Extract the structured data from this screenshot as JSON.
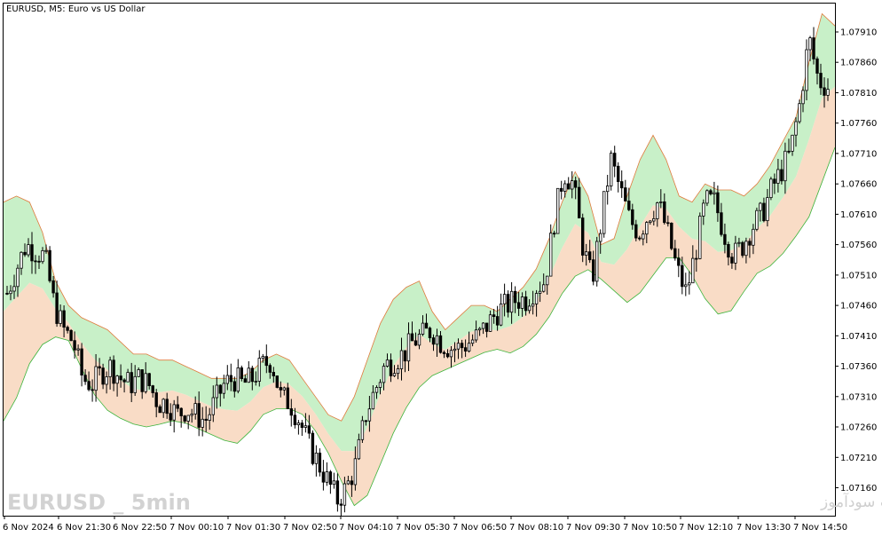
{
  "header": {
    "title": "EURUSD, M5:  Euro vs US Dollar"
  },
  "watermarks": {
    "left": "EURUSD _ 5min",
    "right": "انتشار در سایت سودآموز"
  },
  "colors": {
    "upper_band": "#c8f0c8",
    "lower_band": "#f9dcc6",
    "band_line": "#e07a3c",
    "candle": "#000000",
    "grid_frame": "#000000"
  },
  "chart_data": {
    "type": "candlestick",
    "symbol": "EURUSD",
    "timeframe": "M5",
    "ylim": [
      1.0712,
      1.0794
    ],
    "y_ticks": [
      "1.07910",
      "1.07860",
      "1.07810",
      "1.07760",
      "1.07710",
      "1.07660",
      "1.07610",
      "1.07560",
      "1.07510",
      "1.07460",
      "1.07410",
      "1.07360",
      "1.07310",
      "1.07260",
      "1.07210",
      "1.07160"
    ],
    "x_ticks": [
      "6 Nov 2024",
      "6 Nov 21:30",
      "6 Nov 22:50",
      "7 Nov 00:10",
      "7 Nov 01:30",
      "7 Nov 02:50",
      "7 Nov 04:10",
      "7 Nov 05:30",
      "7 Nov 06:50",
      "7 Nov 08:10",
      "7 Nov 09:30",
      "7 Nov 10:50",
      "7 Nov 12:10",
      "7 Nov 13:30",
      "7 Nov 14:50"
    ],
    "close_path": [
      1.0748,
      1.0752,
      1.0756,
      1.0755,
      1.0754,
      1.0746,
      1.0742,
      1.074,
      1.0734,
      1.0733,
      1.0735,
      1.0736,
      1.0734,
      1.0733,
      1.0734,
      1.0733,
      1.073,
      1.073,
      1.0728,
      1.0729,
      1.0728,
      1.0727,
      1.073,
      1.0733,
      1.0734,
      1.0733,
      1.0734,
      1.0736,
      1.0737,
      1.0731,
      1.073,
      1.0727,
      1.0723,
      1.072,
      1.0717,
      1.0714,
      1.0716,
      1.072,
      1.0728,
      1.0732,
      1.0736,
      1.0737,
      1.0738,
      1.074,
      1.0741,
      1.0742,
      1.074,
      1.0739,
      1.0739,
      1.074,
      1.0741,
      1.0743,
      1.0745,
      1.0746,
      1.0747,
      1.0747,
      1.0749,
      1.075,
      1.076,
      1.0768,
      1.0766,
      1.0756,
      1.075,
      1.076,
      1.077,
      1.0765,
      1.076,
      1.0758,
      1.0761,
      1.0763,
      1.0758,
      1.0752,
      1.0748,
      1.0755,
      1.0763,
      1.0763,
      1.0758,
      1.0754,
      1.0756,
      1.0759,
      1.0761,
      1.0765,
      1.0768,
      1.0771,
      1.0779,
      1.079,
      1.0783,
      1.0782
    ],
    "band_upper": [
      1.0763,
      1.0764,
      1.0763,
      1.0758,
      1.075,
      1.0746,
      1.0744,
      1.0743,
      1.0742,
      1.074,
      1.0738,
      1.0738,
      1.0737,
      1.0737,
      1.0736,
      1.0735,
      1.0734,
      1.0734,
      1.0734,
      1.0735,
      1.0737,
      1.0738,
      1.0737,
      1.0734,
      1.0731,
      1.0728,
      1.0727,
      1.0731,
      1.0737,
      1.0743,
      1.0747,
      1.0749,
      1.075,
      1.0745,
      1.0742,
      1.0744,
      1.0746,
      1.0746,
      1.0745,
      1.0747,
      1.0749,
      1.0752,
      1.0757,
      1.0763,
      1.0768,
      1.0764,
      1.0756,
      1.0757,
      1.0764,
      1.077,
      1.0774,
      1.077,
      1.0764,
      1.0763,
      1.0766,
      1.0765,
      1.0765,
      1.0764,
      1.0766,
      1.0769,
      1.0773,
      1.0777,
      1.0786,
      1.0794,
      1.0792
    ],
    "band_lower": [
      1.0727,
      1.0731,
      1.0737,
      1.074,
      1.0741,
      1.074,
      1.0734,
      1.073,
      1.0728,
      1.0727,
      1.0726,
      1.0726,
      1.0727,
      1.0727,
      1.0726,
      1.0725,
      1.0724,
      1.0723,
      1.0725,
      1.0728,
      1.0729,
      1.0729,
      1.0728,
      1.0725,
      1.0721,
      1.0716,
      1.0712,
      1.0716,
      1.0722,
      1.0727,
      1.0731,
      1.0734,
      1.0735,
      1.0736,
      1.0737,
      1.0738,
      1.0739,
      1.0738,
      1.0739,
      1.0741,
      1.0744,
      1.0748,
      1.0751,
      1.0752,
      1.075,
      1.0748,
      1.0746,
      1.0749,
      1.0752,
      1.0755,
      1.0753,
      1.0749,
      1.0745,
      1.0744,
      1.0747,
      1.0751,
      1.0752,
      1.0754,
      1.0757,
      1.076,
      1.0766,
      1.0772
    ]
  }
}
